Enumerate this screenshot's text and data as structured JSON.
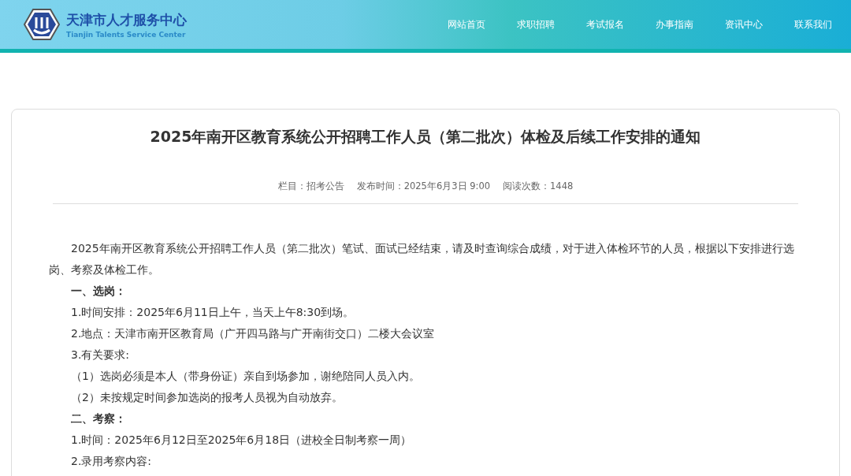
{
  "header": {
    "site_name": "天津市人才服务中心",
    "site_name_en": "Tianjin Talents Service Center"
  },
  "nav": [
    {
      "label": "网站首页"
    },
    {
      "label": "求职招聘"
    },
    {
      "label": "考试报名"
    },
    {
      "label": "办事指南"
    },
    {
      "label": "资讯中心"
    },
    {
      "label": "联系我们"
    }
  ],
  "article": {
    "title": "2025年南开区教育系统公开招聘工作人员（第二批次）体检及后续工作安排的通知",
    "meta": [
      "栏目：招考公告",
      "发布时间：2025年6月3日 9:00",
      "阅读次数：1448"
    ],
    "paragraphs": [
      {
        "kind": "para",
        "text": "2025年南开区教育系统公开招聘工作人员（第二批次）笔试、面试已经结束，请及时查询综合成绩，对于进入体检环节的人员，根据以下安排进行选岗、考察及体检工作。"
      },
      {
        "kind": "heading",
        "text": "一、选岗："
      },
      {
        "kind": "line",
        "text": "1.时间安排：2025年6月11日上午，当天上午8:30到场。"
      },
      {
        "kind": "line",
        "text": "2.地点：天津市南开区教育局（广开四马路与广开南街交口）二楼大会议室"
      },
      {
        "kind": "line",
        "text": "3.有关要求:"
      },
      {
        "kind": "line",
        "text": "（1）选岗必须是本人（带身份证）亲自到场参加，谢绝陪同人员入内。"
      },
      {
        "kind": "line",
        "text": "（2）未按规定时间参加选岗的报考人员视为自动放弃。"
      },
      {
        "kind": "heading",
        "text": "二、考察："
      },
      {
        "kind": "line",
        "text": "1.时间：2025年6月12日至2025年6月18日（进校全日制考察一周）"
      },
      {
        "kind": "line",
        "text": "2.录用考察内容:"
      }
    ]
  }
}
